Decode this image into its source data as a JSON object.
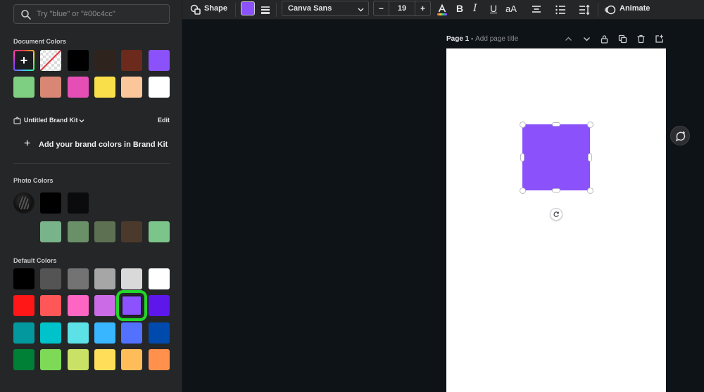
{
  "sidebar": {
    "search": {
      "placeholder": "Try \"blue\" or \"#00c4cc\""
    },
    "document_colors": {
      "label": "Document Colors",
      "add_icon": "plus-icon",
      "swatches": [
        "#000000",
        "#2f241d",
        "#6b2a1b",
        "#8b51fb",
        "#7fcf82",
        "#d98774",
        "#e54fb5",
        "#f9e04b",
        "#fbc79a",
        "#ffffff"
      ]
    },
    "brand_kit": {
      "name": "Untitled Brand Kit",
      "edit_label": "Edit",
      "add_label": "Add your brand colors in Brand Kit"
    },
    "photo_colors": {
      "label": "Photo Colors",
      "row1": [
        "#000000",
        "#0b0b0e"
      ],
      "row2": [
        "#79b38a",
        "#6a9068",
        "#5d7152",
        "#4b3a2b",
        "#7cc58a"
      ]
    },
    "default_colors": {
      "label": "Default Colors",
      "rows": [
        [
          "#000000",
          "#545454",
          "#737373",
          "#a6a6a6",
          "#d9d9d9",
          "#ffffff"
        ],
        [
          "#ff1616",
          "#ff5757",
          "#ff66c4",
          "#cb6ce6",
          "#8c52ff",
          "#5e17eb"
        ],
        [
          "#03989e",
          "#00c2cb",
          "#5ce1e6",
          "#38b6ff",
          "#5271ff",
          "#004aad"
        ],
        [
          "#008037",
          "#7ed957",
          "#c9e265",
          "#ffde59",
          "#ffbd59",
          "#ff914d"
        ]
      ],
      "selected": "#8c52ff"
    }
  },
  "toolbar": {
    "shape_label": "Shape",
    "fill_color": "#8b51fb",
    "font_family": "Canva Sans",
    "font_size": "19",
    "minus": "−",
    "plus": "+",
    "case_label": "aA",
    "animate_label": "Animate"
  },
  "page": {
    "prefix": "Page 1",
    "separator": " - ",
    "title_placeholder": "Add page title",
    "shape_color": "#8b51fb"
  }
}
